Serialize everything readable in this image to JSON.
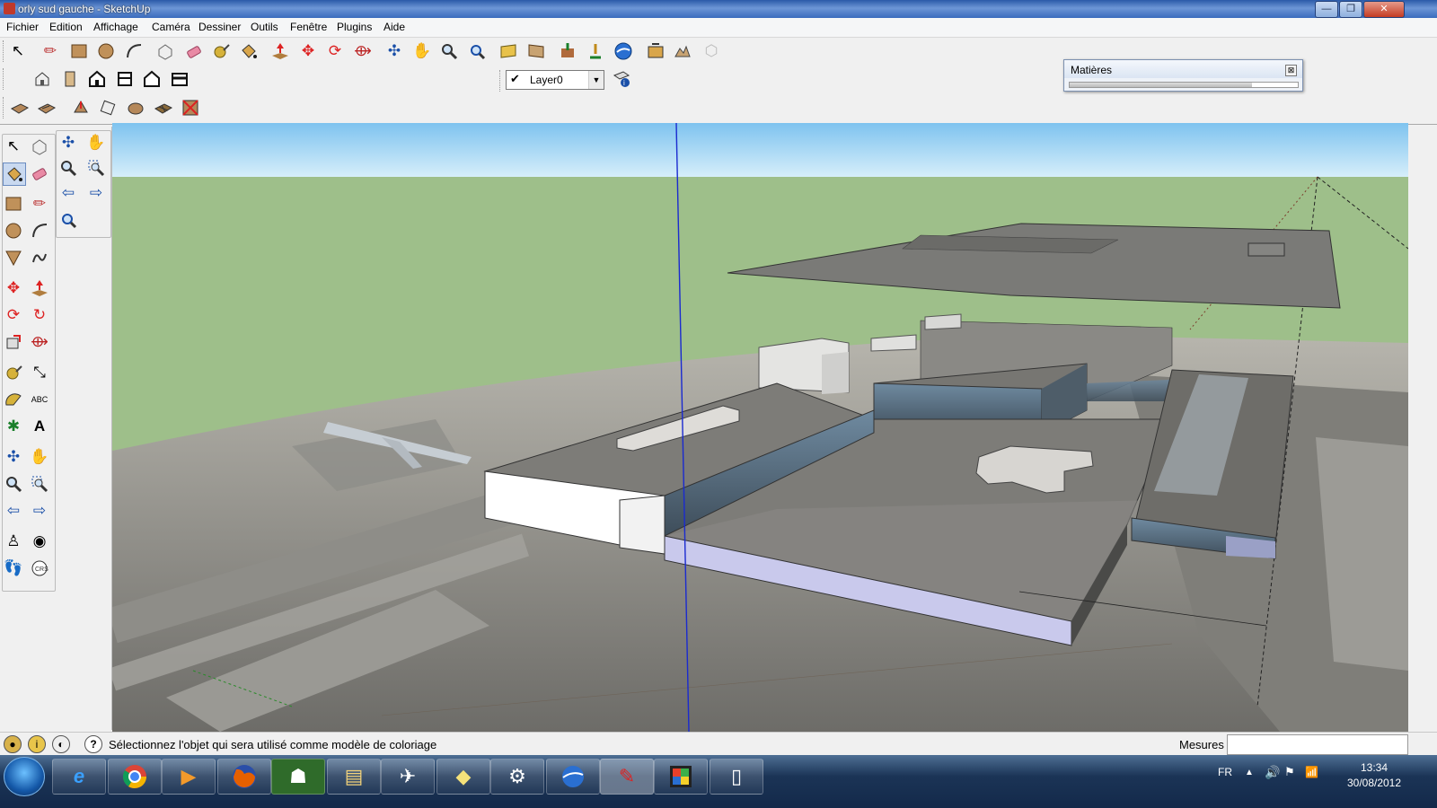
{
  "window": {
    "title": "orly sud gauche - SketchUp",
    "buttons": [
      "—",
      "❐",
      "✕"
    ]
  },
  "menu": [
    "Fichier",
    "Edition",
    "Affichage",
    "Caméra",
    "Dessiner",
    "Outils",
    "Fenêtre",
    "Plugins",
    "Aide"
  ],
  "toolbar": {
    "row1_icons": [
      "select-icon",
      "pencil-icon",
      "rectangle-icon",
      "circle-icon",
      "arc-icon",
      "make-component-icon",
      "eraser-icon",
      "tape-measure-icon",
      "paint-bucket-icon",
      "push-pull-icon",
      "move-icon",
      "rotate-icon",
      "offset-icon",
      "orbit-icon",
      "pan-icon",
      "zoom-icon",
      "zoom-extents-icon",
      "previous-view-icon",
      "next-view-icon",
      "get-models-icon",
      "share-model-icon",
      "google-earth-icon",
      "get-photo-icon",
      "toggle-terrain-icon",
      "place-model-icon",
      "share-component-icon"
    ],
    "row2_icons": [
      "iso-view-icon",
      "top-view-icon",
      "front-view-icon",
      "right-view-icon",
      "back-view-icon",
      "left-view-icon"
    ],
    "row3_icons": [
      "sandbox-contours-icon",
      "sandbox-scratch-icon",
      "smoove-icon",
      "stamp-icon",
      "drape-icon",
      "add-detail-icon",
      "flip-edge-icon"
    ],
    "layer": {
      "name": "Layer0",
      "checked": "✔"
    }
  },
  "materials_panel": {
    "title": "Matières",
    "close": "⊠",
    "progress": 0.8
  },
  "status": {
    "message": "Sélectionnez l'objet qui sera utilisé comme modèle de coloriage",
    "measure_label": "Mesures",
    "help": "?"
  },
  "taskbar": {
    "apps": [
      "internet-explorer",
      "chrome",
      "media-player",
      "firefox",
      "game-app",
      "explorer",
      "airplane-app",
      "notes",
      "network-app",
      "google-earth",
      "sketchup",
      "color-app",
      "notepad"
    ],
    "lang": "FR",
    "time": "13:34",
    "date": "30/08/2012"
  }
}
